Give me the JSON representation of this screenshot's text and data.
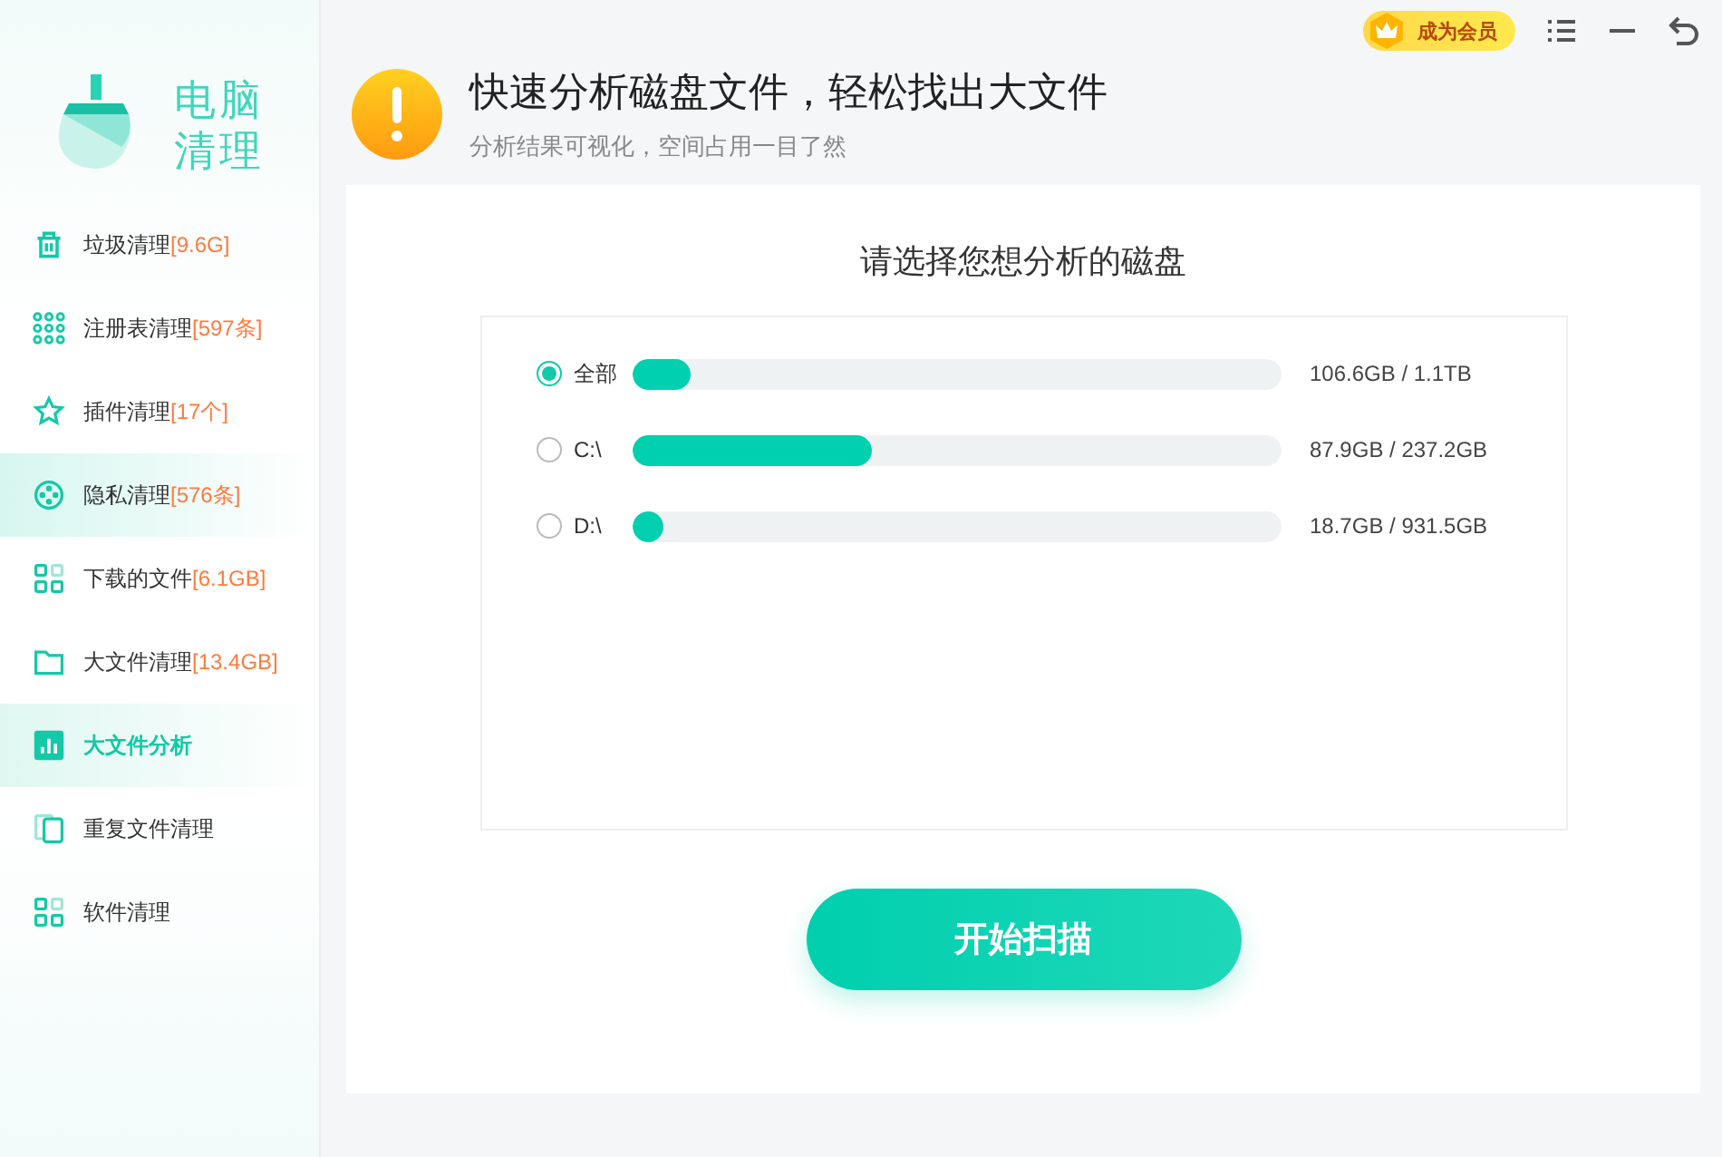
{
  "app": {
    "name_line_1": "电脑",
    "name_line_2": "清理"
  },
  "sidebar": {
    "items": [
      {
        "label": "垃圾清理",
        "count": "[9.6G]",
        "kind": "trash",
        "selected": false,
        "highlighted": false
      },
      {
        "label": "注册表清理",
        "count": "[597条]",
        "kind": "grid",
        "selected": false,
        "highlighted": false
      },
      {
        "label": "插件清理",
        "count": "[17个]",
        "kind": "puzzle",
        "selected": false,
        "highlighted": false
      },
      {
        "label": "隐私清理",
        "count": "[576条]",
        "kind": "reel",
        "selected": false,
        "highlighted": true
      },
      {
        "label": "下载的文件",
        "count": "[6.1GB]",
        "kind": "tiles",
        "selected": false,
        "highlighted": false
      },
      {
        "label": "大文件清理",
        "count": "[13.4GB]",
        "kind": "folder",
        "selected": false,
        "highlighted": false
      },
      {
        "label": "大文件分析",
        "kind": "chart",
        "selected": true,
        "highlighted": false
      },
      {
        "label": "重复文件清理",
        "kind": "copy",
        "selected": false,
        "highlighted": false
      },
      {
        "label": "软件清理",
        "kind": "tiles",
        "selected": false,
        "highlighted": false
      }
    ]
  },
  "top_bar": {
    "member_button": "成为会员"
  },
  "header": {
    "title": "快速分析磁盘文件，轻松找出大文件",
    "subtitle": "分析结果可视化，空间占用一目了然"
  },
  "panel": {
    "heading": "请选择您想分析的磁盘",
    "disks": [
      {
        "name": "全部",
        "selected": true,
        "level": 0.09,
        "reading": "106.6GB / 1.1TB"
      },
      {
        "name": "C:\\",
        "selected": false,
        "level": 0.37,
        "reading": "87.9GB / 237.2GB"
      },
      {
        "name": "D:\\",
        "selected": false,
        "level": 0.05,
        "reading": "18.7GB / 931.5GB"
      }
    ],
    "scan_button": "开始扫描"
  }
}
